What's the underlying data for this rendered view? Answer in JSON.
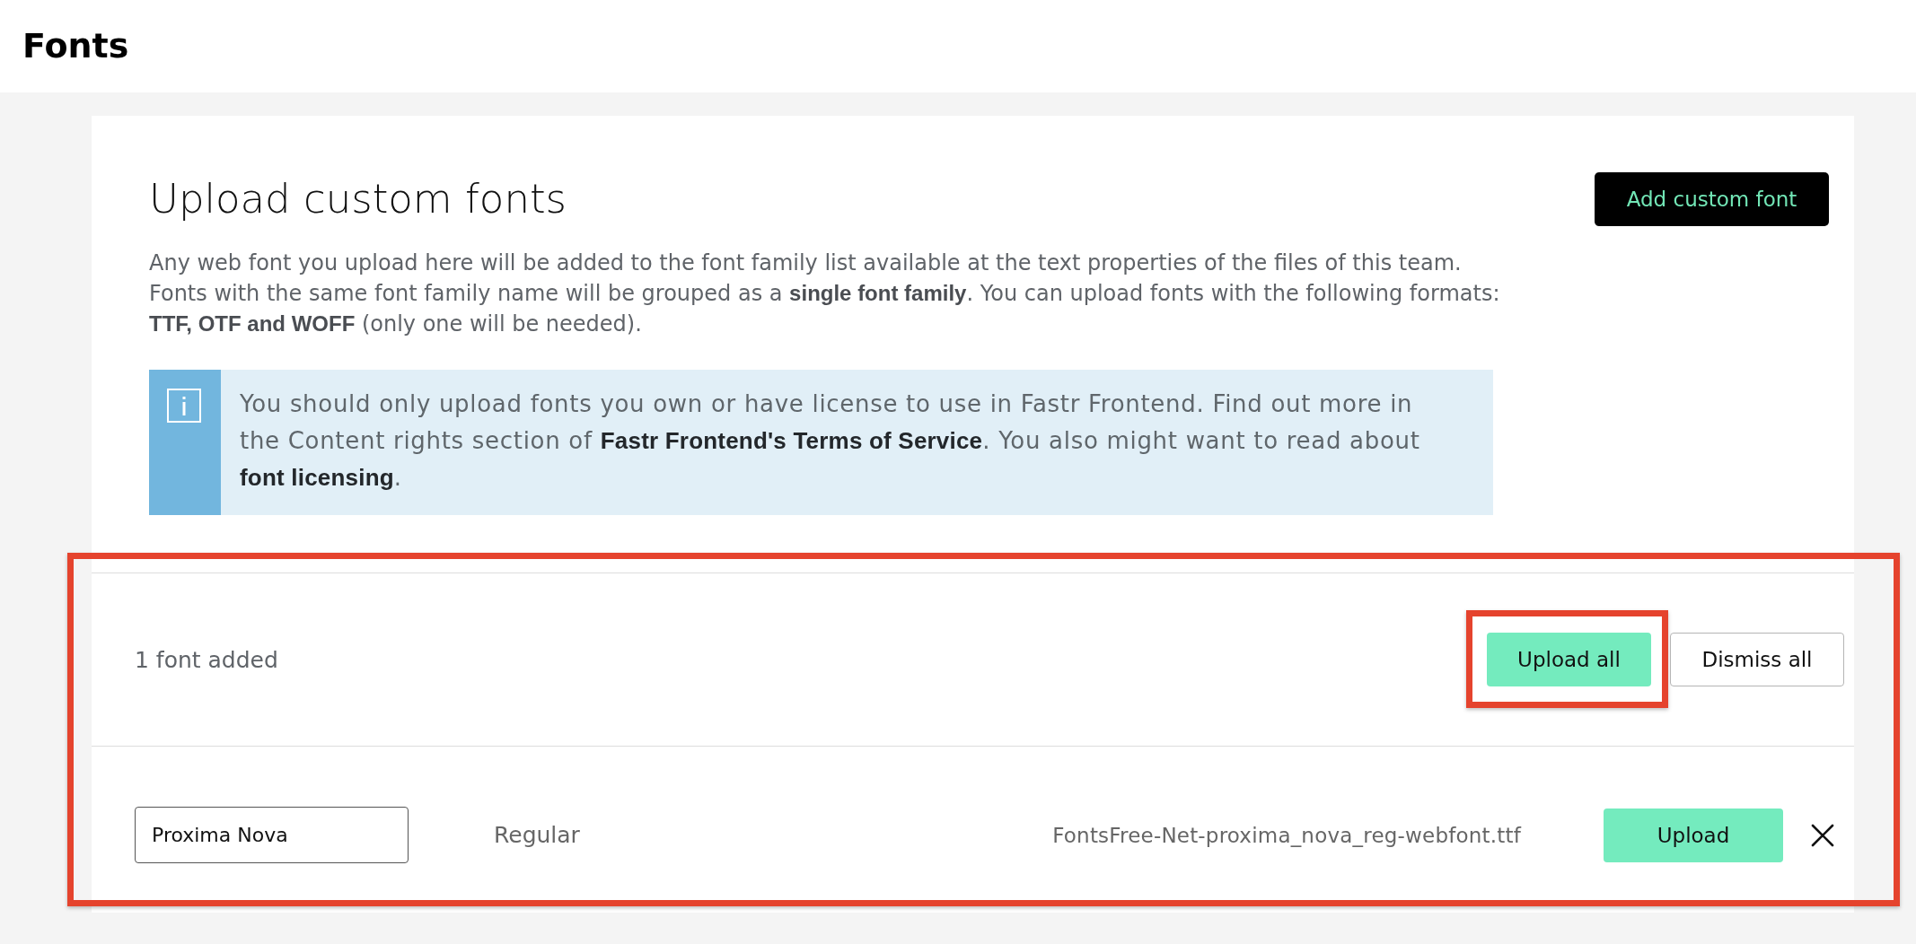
{
  "page": {
    "title": "Fonts"
  },
  "custom_fonts": {
    "title": "Upload custom fonts",
    "add_button": "Add custom font",
    "description": "Any web font you upload here will be added to the font family list available at the text properties of the files of this team. Fonts with the same font family name will be grouped as a **single font family**. You can upload fonts with the following formats: **TTF, OTF and WOFF** (only one will be needed).",
    "notice": "You should only upload fonts you own or have license to use in Fastr Frontend. Find out more in the Content rights section of **Fastr Frontend's Terms of Service**. You also might want to read about **font licensing**."
  },
  "upload_panel": {
    "highlighted": true,
    "summary": "1 font added",
    "buttons": [
      {
        "label": "Upload all",
        "kind": "primary",
        "highlighted": true
      },
      {
        "label": "Dismiss all",
        "kind": "secondary",
        "highlighted": false
      }
    ],
    "fonts": [
      {
        "family": "Proxima Nova",
        "style": "Regular",
        "file": "FontsFree-Net-proxima_nova_reg-webfont.ttf",
        "upload_button": "Upload"
      }
    ]
  }
}
